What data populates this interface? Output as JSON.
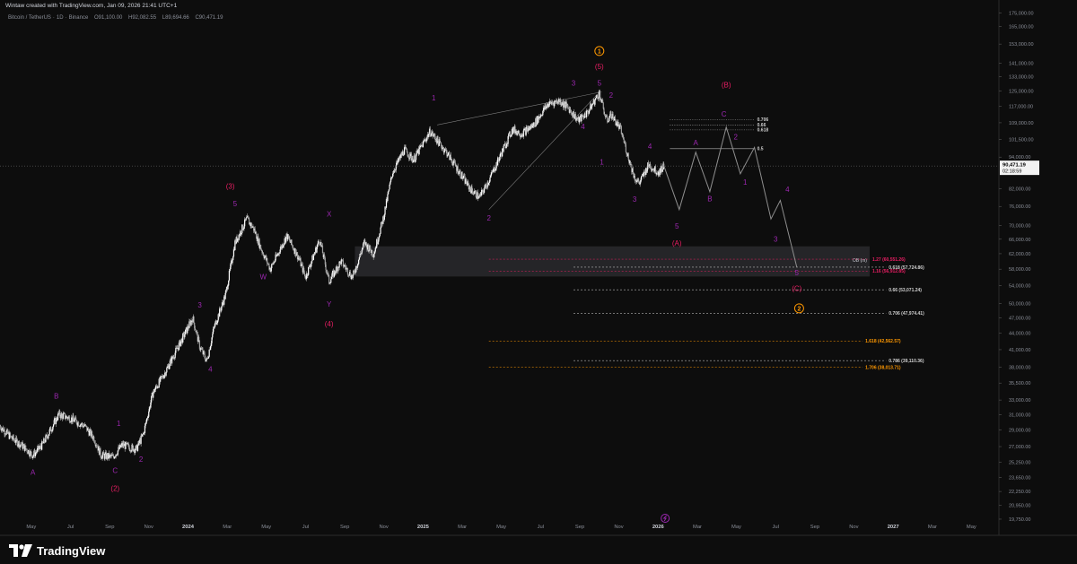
{
  "header": {
    "title": "Wintaw created with TradingView.com, Jan 09, 2026 21:41 UTC+1"
  },
  "symbol": {
    "pair": "Bitcoin / TetherUS",
    "interval": "1D",
    "exchange": "Binance",
    "ohlc": [
      {
        "key": "O",
        "value": "91,100.00"
      },
      {
        "key": "H",
        "value": "92,082.55"
      },
      {
        "key": "L",
        "value": "89,694.66"
      },
      {
        "key": "C",
        "value": "90,471.19"
      }
    ]
  },
  "logo": {
    "text": "TradingView"
  },
  "colors": {
    "background": "#0d0d0d",
    "candle": "#d8d8d8",
    "minor_wave": "#9c27b0",
    "primary_wave": "#e91e63",
    "cycle_wave": "#ff9800",
    "fib_white": "#ffffff",
    "fib_orange": "#ff9800",
    "fib_pink": "#e91e63",
    "zone": "#3a3b3f"
  },
  "chart_data": {
    "type": "candlestick",
    "scale": "log",
    "ylim": [
      19000,
      178000
    ],
    "y_ticks": [
      "175,000.00",
      "165,000.00",
      "153,000.00",
      "141,000.00",
      "133,000.00",
      "125,000.00",
      "117,000.00",
      "109,000.00",
      "101,500.00",
      "94,000.00",
      "82,000.00",
      "76,000.00",
      "70,000.00",
      "66,000.00",
      "62,000.00",
      "58,000.00",
      "54,000.00",
      "50,000.00",
      "47,000.00",
      "44,000.00",
      "41,000.00",
      "38,000.00",
      "35,500.00",
      "33,000.00",
      "31,000.00",
      "29,000.00",
      "27,000.00",
      "25,250.00",
      "23,650.00",
      "22,250.00",
      "20,950.00",
      "19,750.00"
    ],
    "last_price": "90,471.19",
    "countdown": "02:18:59",
    "x_ticks": [
      {
        "label": "May",
        "t": 2023.333
      },
      {
        "label": "Jul",
        "t": 2023.5
      },
      {
        "label": "Sep",
        "t": 2023.667
      },
      {
        "label": "Nov",
        "t": 2023.833
      },
      {
        "label": "2024",
        "t": 2024.0
      },
      {
        "label": "Mar",
        "t": 2024.167
      },
      {
        "label": "May",
        "t": 2024.333
      },
      {
        "label": "Jul",
        "t": 2024.5
      },
      {
        "label": "Sep",
        "t": 2024.667
      },
      {
        "label": "Nov",
        "t": 2024.833
      },
      {
        "label": "2025",
        "t": 2025.0
      },
      {
        "label": "Mar",
        "t": 2025.167
      },
      {
        "label": "May",
        "t": 2025.333
      },
      {
        "label": "Jul",
        "t": 2025.5
      },
      {
        "label": "Sep",
        "t": 2025.667
      },
      {
        "label": "Nov",
        "t": 2025.833
      },
      {
        "label": "2026",
        "t": 2026.0
      },
      {
        "label": "Mar",
        "t": 2026.167
      },
      {
        "label": "May",
        "t": 2026.333
      },
      {
        "label": "Jul",
        "t": 2026.5
      },
      {
        "label": "Sep",
        "t": 2026.667
      },
      {
        "label": "Nov",
        "t": 2026.833
      },
      {
        "label": "2027",
        "t": 2027.0
      },
      {
        "label": "Mar",
        "t": 2027.167
      },
      {
        "label": "May",
        "t": 2027.333
      }
    ],
    "price_anchors": [
      [
        2023.2,
        29500
      ],
      [
        2023.25,
        28000
      ],
      [
        2023.3,
        27000
      ],
      [
        2023.34,
        26000
      ],
      [
        2023.38,
        27200
      ],
      [
        2023.45,
        31000
      ],
      [
        2023.5,
        30500
      ],
      [
        2023.56,
        29500
      ],
      [
        2023.6,
        28000
      ],
      [
        2023.63,
        26000
      ],
      [
        2023.68,
        25800
      ],
      [
        2023.72,
        27200
      ],
      [
        2023.78,
        26700
      ],
      [
        2023.81,
        28500
      ],
      [
        2023.85,
        34000
      ],
      [
        2023.9,
        37000
      ],
      [
        2023.97,
        42500
      ],
      [
        2024.02,
        47000
      ],
      [
        2024.05,
        41500
      ],
      [
        2024.08,
        39000
      ],
      [
        2024.11,
        45000
      ],
      [
        2024.16,
        52000
      ],
      [
        2024.2,
        65000
      ],
      [
        2024.25,
        72000
      ],
      [
        2024.28,
        69000
      ],
      [
        2024.31,
        63500
      ],
      [
        2024.35,
        58000
      ],
      [
        2024.42,
        67000
      ],
      [
        2024.47,
        61000
      ],
      [
        2024.5,
        56000
      ],
      [
        2024.56,
        66000
      ],
      [
        2024.6,
        55000
      ],
      [
        2024.65,
        60000
      ],
      [
        2024.7,
        56000
      ],
      [
        2024.75,
        65000
      ],
      [
        2024.79,
        62000
      ],
      [
        2024.83,
        72000
      ],
      [
        2024.87,
        88000
      ],
      [
        2024.92,
        97000
      ],
      [
        2024.96,
        93000
      ],
      [
        2025.03,
        105000
      ],
      [
        2025.1,
        96000
      ],
      [
        2025.17,
        86000
      ],
      [
        2025.2,
        82000
      ],
      [
        2025.24,
        79000
      ],
      [
        2025.28,
        85000
      ],
      [
        2025.34,
        97000
      ],
      [
        2025.38,
        106000
      ],
      [
        2025.42,
        104000
      ],
      [
        2025.47,
        108000
      ],
      [
        2025.53,
        118000
      ],
      [
        2025.58,
        120000
      ],
      [
        2025.62,
        116000
      ],
      [
        2025.66,
        110000
      ],
      [
        2025.7,
        114000
      ],
      [
        2025.75,
        124000
      ],
      [
        2025.78,
        110000
      ],
      [
        2025.8,
        113000
      ],
      [
        2025.84,
        106000
      ],
      [
        2025.87,
        95000
      ],
      [
        2025.9,
        86000
      ],
      [
        2025.92,
        84000
      ],
      [
        2025.96,
        91000
      ],
      [
        2026.0,
        88000
      ],
      [
        2026.025,
        90500
      ]
    ],
    "projection": [
      [
        2026.025,
        90471
      ],
      [
        2026.09,
        75000
      ],
      [
        2026.16,
        96000
      ],
      [
        2026.22,
        81000
      ],
      [
        2026.29,
        107000
      ],
      [
        2026.35,
        87500
      ],
      [
        2026.41,
        98000
      ],
      [
        2026.48,
        72000
      ],
      [
        2026.52,
        78000
      ],
      [
        2026.59,
        58500
      ]
    ],
    "trendlines": [
      {
        "from": [
          2025.06,
          108000
        ],
        "to": [
          2025.76,
          124500
        ]
      },
      {
        "from": [
          2025.28,
          75000
        ],
        "to": [
          2025.74,
          123000
        ]
      }
    ],
    "support_zone": {
      "from_t": 2024.71,
      "to_t": 2026.9,
      "low": 56200,
      "high": 64000
    },
    "fib_levels": [
      {
        "label": "0.706",
        "value": 110500,
        "from_t": 2026.05,
        "to_t": 2026.41,
        "color": "#cfcfcf",
        "style": "dotted"
      },
      {
        "label": "0.66",
        "value": 108000,
        "from_t": 2026.05,
        "to_t": 2026.41,
        "color": "#cfcfcf",
        "style": "dotted"
      },
      {
        "label": "0.618",
        "value": 105700,
        "from_t": 2026.05,
        "to_t": 2026.41,
        "color": "#cfcfcf",
        "style": "dotted"
      },
      {
        "label": "0.5",
        "value": 97500,
        "from_t": 2026.05,
        "to_t": 2026.41,
        "color": "#cfcfcf",
        "style": "solid"
      },
      {
        "label": "1.27 (60,551.26)",
        "value": 60551,
        "from_t": 2025.28,
        "to_t": 2026.9,
        "color": "#e91e63",
        "style": "dashed"
      },
      {
        "label": "1.16 (56,912.85)",
        "value": 57500,
        "from_t": 2025.28,
        "to_t": 2026.9,
        "color": "#e91e63",
        "style": "dashed"
      },
      {
        "label": "0.618 (57,724.86)",
        "value": 58500,
        "from_t": 2025.64,
        "to_t": 2026.97,
        "color": "#cfcfcf",
        "style": "dashed"
      },
      {
        "label": "0.66 (53,071.24)",
        "value": 53071,
        "from_t": 2025.64,
        "to_t": 2026.97,
        "color": "#cfcfcf",
        "style": "dashed"
      },
      {
        "label": "0.706 (47,974.41)",
        "value": 47974,
        "from_t": 2025.64,
        "to_t": 2026.97,
        "color": "#cfcfcf",
        "style": "dashed"
      },
      {
        "label": "1.618 (42,562.57)",
        "value": 42562,
        "from_t": 2025.28,
        "to_t": 2026.87,
        "color": "#ff9800",
        "style": "dashed"
      },
      {
        "label": "0.786 (39,110.36)",
        "value": 39110,
        "from_t": 2025.64,
        "to_t": 2026.97,
        "color": "#cfcfcf",
        "style": "dashed"
      },
      {
        "label": "1.706 (38,013.71)",
        "value": 38013,
        "from_t": 2025.28,
        "to_t": 2026.87,
        "color": "#ff9800",
        "style": "dashed"
      }
    ],
    "zone_label": "OB (m)",
    "wave_labels": [
      {
        "text": "A",
        "t": 2023.34,
        "v": 23900,
        "color": "#9c27b0"
      },
      {
        "text": "B",
        "t": 2023.44,
        "v": 33200,
        "color": "#9c27b0"
      },
      {
        "text": "1",
        "t": 2023.705,
        "v": 29500,
        "color": "#9c27b0"
      },
      {
        "text": "C",
        "t": 2023.69,
        "v": 24100,
        "color": "#9c27b0"
      },
      {
        "text": "2",
        "t": 2023.8,
        "v": 25300,
        "color": "#9c27b0"
      },
      {
        "text": "(2)",
        "t": 2023.69,
        "v": 22300,
        "color": "#e91e63"
      },
      {
        "text": "3",
        "t": 2024.05,
        "v": 49200,
        "color": "#9c27b0"
      },
      {
        "text": "4",
        "t": 2024.095,
        "v": 37300,
        "color": "#9c27b0"
      },
      {
        "text": "(3)",
        "t": 2024.18,
        "v": 82000,
        "color": "#e91e63"
      },
      {
        "text": "5",
        "t": 2024.2,
        "v": 76000,
        "color": "#9c27b0"
      },
      {
        "text": "W",
        "t": 2024.32,
        "v": 55500,
        "color": "#9c27b0"
      },
      {
        "text": "X",
        "t": 2024.6,
        "v": 72800,
        "color": "#9c27b0"
      },
      {
        "text": "Y",
        "t": 2024.6,
        "v": 49300,
        "color": "#9c27b0"
      },
      {
        "text": "(4)",
        "t": 2024.6,
        "v": 45300,
        "color": "#e91e63"
      },
      {
        "text": "1",
        "t": 2025.045,
        "v": 120000,
        "color": "#9c27b0"
      },
      {
        "text": "2",
        "t": 2025.28,
        "v": 71500,
        "color": "#9c27b0"
      },
      {
        "text": "3",
        "t": 2025.64,
        "v": 128000,
        "color": "#9c27b0"
      },
      {
        "text": "4",
        "t": 2025.68,
        "v": 106000,
        "color": "#9c27b0"
      },
      {
        "text": "5",
        "t": 2025.75,
        "v": 128000,
        "color": "#9c27b0"
      },
      {
        "text": "(5)",
        "t": 2025.75,
        "v": 137500,
        "color": "#e91e63"
      },
      {
        "text": "2",
        "t": 2025.8,
        "v": 121500,
        "color": "#9c27b0"
      },
      {
        "text": "1",
        "t": 2025.76,
        "v": 91000,
        "color": "#9c27b0"
      },
      {
        "text": "3",
        "t": 2025.9,
        "v": 77500,
        "color": "#9c27b0"
      },
      {
        "text": "4",
        "t": 2025.965,
        "v": 97500,
        "color": "#9c27b0"
      },
      {
        "text": "5",
        "t": 2026.08,
        "v": 69000,
        "color": "#9c27b0"
      },
      {
        "text": "(A)",
        "t": 2026.08,
        "v": 64200,
        "color": "#e91e63"
      },
      {
        "text": "A",
        "t": 2026.16,
        "v": 99000,
        "color": "#9c27b0"
      },
      {
        "text": "B",
        "t": 2026.22,
        "v": 77700,
        "color": "#9c27b0"
      },
      {
        "text": "C",
        "t": 2026.28,
        "v": 112000,
        "color": "#9c27b0"
      },
      {
        "text": "(B)",
        "t": 2026.29,
        "v": 127000,
        "color": "#e91e63"
      },
      {
        "text": "2",
        "t": 2026.33,
        "v": 101500,
        "color": "#9c27b0"
      },
      {
        "text": "1",
        "t": 2026.37,
        "v": 83500,
        "color": "#9c27b0"
      },
      {
        "text": "4",
        "t": 2026.55,
        "v": 81000,
        "color": "#9c27b0"
      },
      {
        "text": "3",
        "t": 2026.5,
        "v": 65300,
        "color": "#9c27b0"
      },
      {
        "text": "5",
        "t": 2026.59,
        "v": 56500,
        "color": "#9c27b0"
      },
      {
        "text": "(C)",
        "t": 2026.59,
        "v": 52800,
        "color": "#e91e63"
      }
    ],
    "circle_labels": [
      {
        "text": "1",
        "t": 2025.75,
        "v": 148500,
        "color": "#ff9800"
      },
      {
        "text": "2",
        "t": 2026.6,
        "v": 49000,
        "color": "#ff9800"
      }
    ]
  }
}
